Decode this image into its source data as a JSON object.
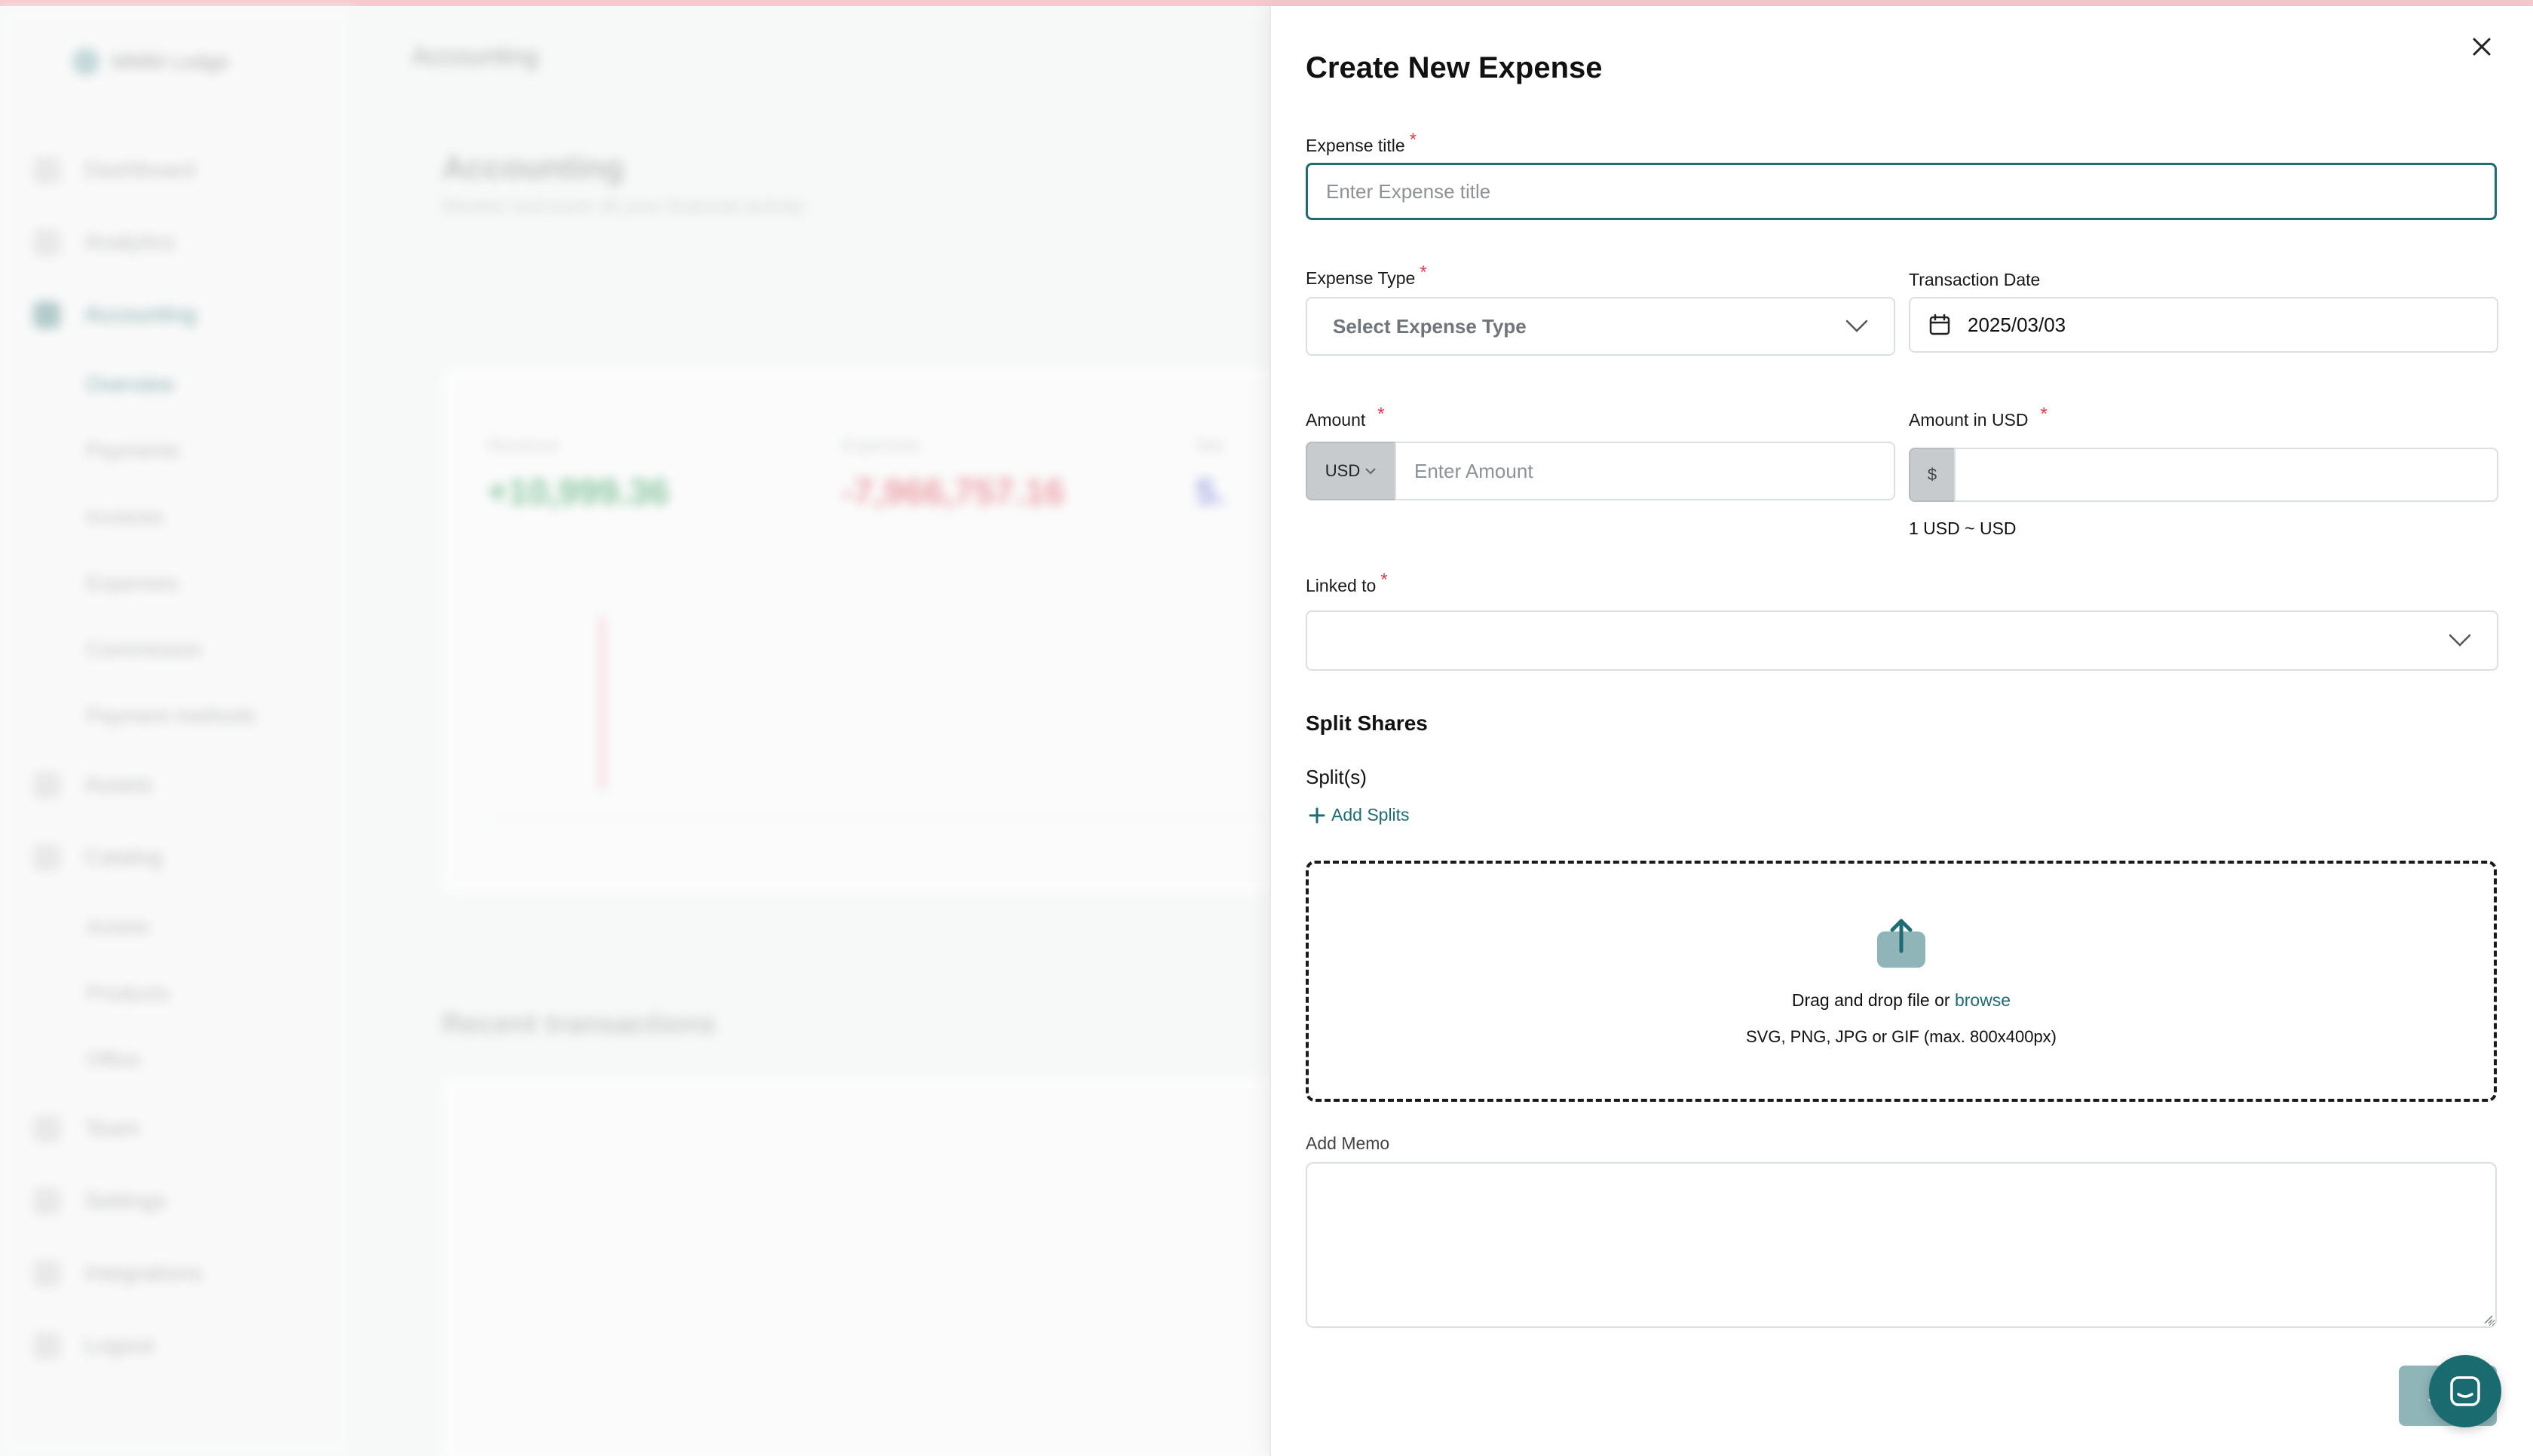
{
  "background": {
    "org_name": "MMM Lodge",
    "header": "Accounting",
    "page_title": "Accounting",
    "page_subtitle": "Monitor and track all your financial activity",
    "nav": [
      {
        "label": "Dashboard",
        "active": false,
        "sub": false
      },
      {
        "label": "Analytics",
        "active": false,
        "sub": false
      },
      {
        "label": "Accounting",
        "active": true,
        "sub": false
      },
      {
        "label": "Overview",
        "active": true,
        "sub": true
      },
      {
        "label": "Payments",
        "active": false,
        "sub": true
      },
      {
        "label": "Invoices",
        "active": false,
        "sub": true
      },
      {
        "label": "Expenses",
        "active": false,
        "sub": true
      },
      {
        "label": "Commission",
        "active": false,
        "sub": true
      },
      {
        "label": "Payment methods",
        "active": false,
        "sub": true
      },
      {
        "label": "Assets",
        "active": false,
        "sub": false
      },
      {
        "label": "Catalog",
        "active": false,
        "sub": false
      },
      {
        "label": "Assets",
        "active": false,
        "sub": true
      },
      {
        "label": "Products",
        "active": false,
        "sub": true
      },
      {
        "label": "Office",
        "active": false,
        "sub": true
      },
      {
        "label": "Team",
        "active": false,
        "sub": false
      },
      {
        "label": "Settings",
        "active": false,
        "sub": false
      },
      {
        "label": "Integrations",
        "active": false,
        "sub": false
      },
      {
        "label": "Logout",
        "active": false,
        "sub": false
      }
    ],
    "stats": [
      {
        "label": "Revenue",
        "value": "+10,999.36",
        "color": "#3aa35f"
      },
      {
        "label": "Expenses",
        "value": "-7,966,757.16",
        "color": "#e35d6a"
      },
      {
        "label": "Net",
        "value": "5.",
        "color": "#6b6fd4"
      }
    ],
    "recent_title": "Recent transactions"
  },
  "drawer": {
    "title": "Create New Expense",
    "expense_title": {
      "label": "Expense title",
      "placeholder": "Enter Expense title",
      "required": "*"
    },
    "expense_type": {
      "label": "Expense Type",
      "placeholder": "Select Expense Type",
      "required": "*"
    },
    "transaction_date": {
      "label": "Transaction Date",
      "value": "2025/03/03"
    },
    "amount": {
      "label": "Amount",
      "required": "*",
      "currency": "USD",
      "placeholder": "Enter Amount"
    },
    "amount_usd": {
      "label": "Amount in USD",
      "required": "*",
      "prefix": "$",
      "value": "",
      "rate_note": "1 USD ~ USD"
    },
    "linked_to": {
      "label": "Linked to",
      "required": "*",
      "value": ""
    },
    "split_shares": {
      "title": "Split Shares",
      "subtitle": "Split(s)",
      "add_label": "Add Splits"
    },
    "upload": {
      "text": "Drag and drop file or",
      "link": "browse",
      "hint": "SVG, PNG, JPG or GIF (max. 800x400px)"
    },
    "memo": {
      "label": "Add Memo",
      "value": ""
    },
    "submit_label": "S"
  },
  "colors": {
    "accent": "#1f6c72",
    "required": "#e23b4a",
    "submit_disabled": "#8fb5b9",
    "chat": "#1a6b70"
  },
  "icons": [
    "close-icon",
    "calendar-icon",
    "chevron-down-icon",
    "plus-icon",
    "upload-icon",
    "chat-icon"
  ]
}
